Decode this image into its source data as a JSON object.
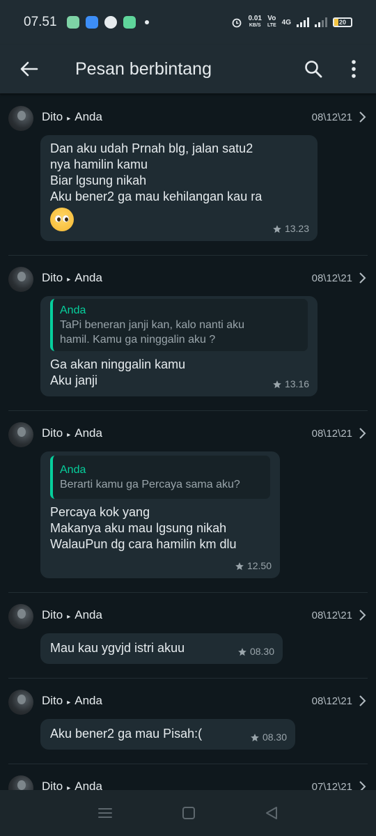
{
  "status": {
    "time": "07.51",
    "speed_value": "0.01",
    "speed_unit": "KB/S",
    "volte": "Vo",
    "volte2": "LTE",
    "net": "4G",
    "battery": "20"
  },
  "header": {
    "title": "Pesan berbintang"
  },
  "messages": [
    {
      "sender": "Dito",
      "recipient": "Anda",
      "date": "08\\12\\21",
      "lines": [
        "Dan aku udah Prnah blg, jalan satu2",
        "nya hamilin kamu",
        "Biar lgsung nikah",
        "Aku bener2 ga mau kehilangan kau ra"
      ],
      "emoji": "pleading-face",
      "time": "13.23"
    },
    {
      "sender": "Dito",
      "recipient": "Anda",
      "date": "08\\12\\21",
      "quote_author": "Anda",
      "quote_lines": [
        "TaPi beneran janji kan, kalo nanti aku",
        "hamil. Kamu ga ninggalin aku ?"
      ],
      "lines": [
        "Ga akan ninggalin kamu",
        "Aku janji"
      ],
      "time": "13.16"
    },
    {
      "sender": "Dito",
      "recipient": "Anda",
      "date": "08\\12\\21",
      "quote_author": "Anda",
      "quote_lines": [
        "Berarti kamu ga Percaya sama aku?"
      ],
      "lines": [
        "Percaya kok yang",
        "Makanya aku mau lgsung nikah",
        "WalauPun dg cara hamilin km dlu"
      ],
      "time": "12.50"
    },
    {
      "sender": "Dito",
      "recipient": "Anda",
      "date": "08\\12\\21",
      "lines": [
        "Mau kau ygvjd istri akuu"
      ],
      "time": "08.30"
    },
    {
      "sender": "Dito",
      "recipient": "Anda",
      "date": "08\\12\\21",
      "lines": [
        "Aku bener2 ga mau Pisah:("
      ],
      "time": "08.30"
    },
    {
      "sender": "Dito",
      "recipient": "Anda",
      "date": "07\\12\\21"
    }
  ],
  "colors": {
    "background": "#0f181d",
    "bar": "#202c33",
    "bubble": "#1f2c33",
    "accent": "#06cf9c"
  }
}
